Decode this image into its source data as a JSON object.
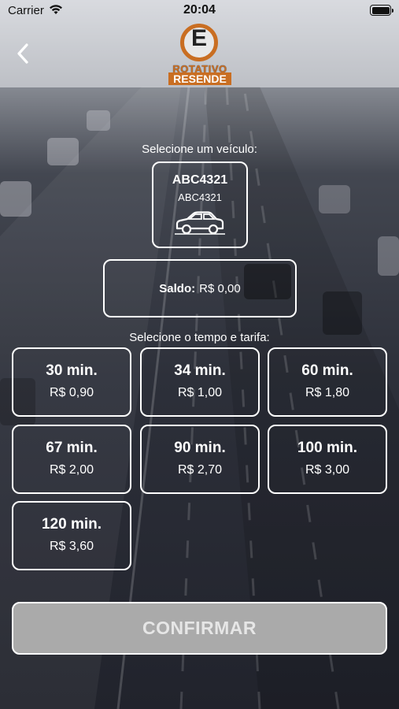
{
  "status_bar": {
    "carrier": "Carrier",
    "time": "20:04"
  },
  "logo": {
    "letter": "E",
    "line1": "ROTATIVO",
    "line2": "RESENDE"
  },
  "vehicle_section": {
    "label": "Selecione um veículo:",
    "vehicle": {
      "plate": "ABC4321",
      "subtitle": "ABC4321",
      "icon": "car-icon"
    }
  },
  "balance": {
    "label": "Saldo:",
    "value": "R$ 0,00"
  },
  "rates_section": {
    "label": "Selecione o tempo e tarifa:",
    "options": [
      {
        "time": "30 min.",
        "price": "R$ 0,90"
      },
      {
        "time": "34 min.",
        "price": "R$ 1,00"
      },
      {
        "time": "60 min.",
        "price": "R$ 1,80"
      },
      {
        "time": "67 min.",
        "price": "R$ 2,00"
      },
      {
        "time": "90 min.",
        "price": "R$ 2,70"
      },
      {
        "time": "100 min.",
        "price": "R$ 3,00"
      },
      {
        "time": "120 min.",
        "price": "R$ 3,60"
      }
    ]
  },
  "confirm_button": {
    "label": "CONFIRMAR"
  },
  "colors": {
    "accent": "#c96e22",
    "confirm_bg": "#aaaaaa",
    "text": "#ffffff"
  }
}
